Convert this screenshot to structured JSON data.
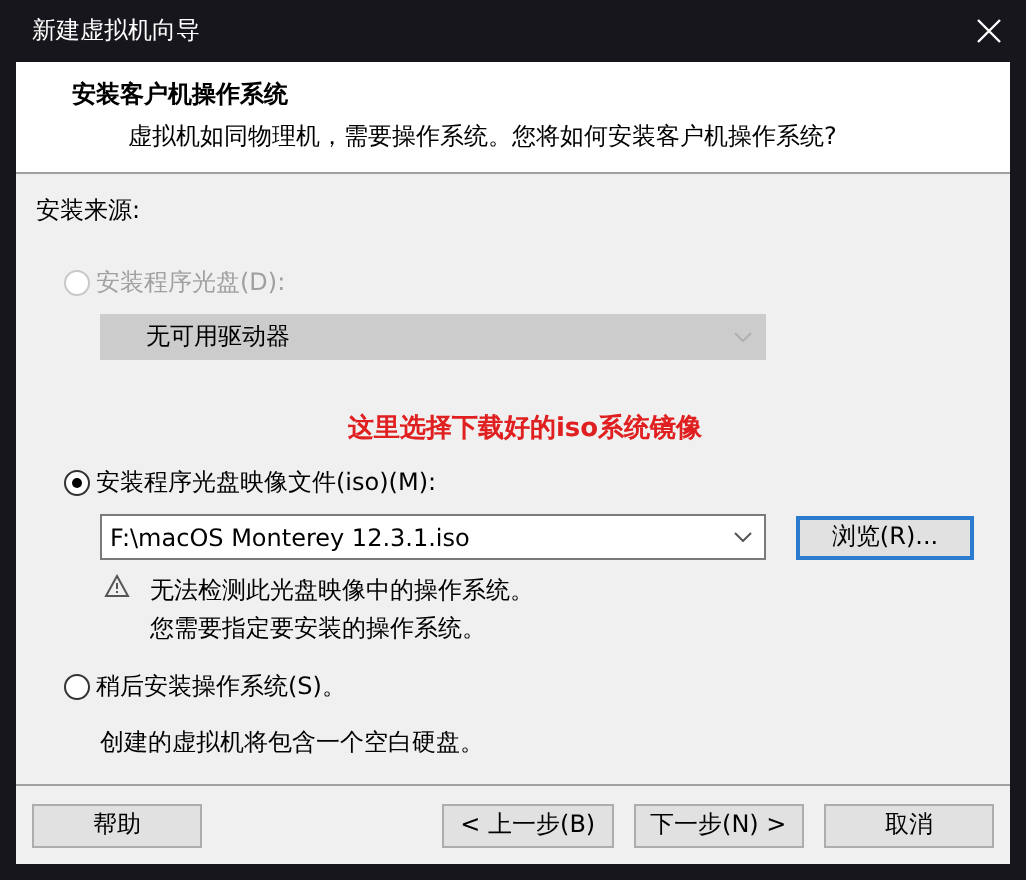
{
  "window": {
    "title": "新建虚拟机向导"
  },
  "header": {
    "title": "安装客户机操作系统",
    "subtitle": "虚拟机如同物理机，需要操作系统。您将如何安装客户机操作系统?"
  },
  "source_label": "安装来源:",
  "options": [
    {
      "label": "安装程序光盘(D):",
      "selected": false,
      "disabled": true,
      "dropdown": {
        "value": "无可用驱动器",
        "disabled": true
      }
    },
    {
      "label": "安装程序光盘映像文件(iso)(M):",
      "selected": true,
      "disabled": false,
      "annotation": "这里选择下载好的iso系统镜像",
      "dropdown": {
        "value": "F:\\macOS Monterey 12.3.1.iso",
        "disabled": false
      },
      "browse_button": "浏览(R)...",
      "warning": [
        "无法检测此光盘映像中的操作系统。",
        "您需要指定要安装的操作系统。"
      ]
    },
    {
      "label": "稍后安装操作系统(S)。",
      "selected": false,
      "disabled": false,
      "note": "创建的虚拟机将包含一个空白硬盘。"
    }
  ],
  "buttons": [
    {
      "label": "帮助",
      "kind": "help"
    },
    {
      "label": "< 上一步(B)",
      "kind": "nav"
    },
    {
      "label": "下一步(N) >",
      "kind": "nav"
    },
    {
      "label": "取消",
      "kind": "nav"
    }
  ]
}
